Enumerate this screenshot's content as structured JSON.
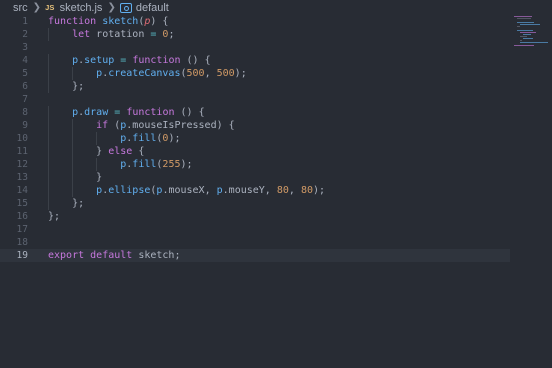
{
  "breadcrumb": {
    "folder": "src",
    "file_badge": "JS",
    "file": "sketch.js",
    "symbol": "default"
  },
  "icons": {
    "separator": "chevron-right-icon",
    "file_type": "javascript-file-icon",
    "symbol": "symbol-variable-icon"
  },
  "theme": {
    "background": "#282c34",
    "keyword": "#c678dd",
    "function": "#61afef",
    "variable": "#e06c75",
    "number": "#d19a66",
    "operator": "#56b6c2",
    "text": "#abb2bf",
    "line_number": "#5c6370"
  },
  "editor": {
    "active_line": 19,
    "lines": [
      {
        "n": "1",
        "tokens": [
          {
            "t": "function ",
            "c": "kw"
          },
          {
            "t": "sketch",
            "c": "fn"
          },
          {
            "t": "(",
            "c": "pl"
          },
          {
            "t": "p",
            "c": "pr"
          },
          {
            "t": ") {",
            "c": "pl"
          }
        ]
      },
      {
        "n": "2",
        "indent": 1,
        "tokens": [
          {
            "t": "let ",
            "c": "kw"
          },
          {
            "t": "rotation ",
            "c": "pl"
          },
          {
            "t": "=",
            "c": "op"
          },
          {
            "t": " ",
            "c": "pl"
          },
          {
            "t": "0",
            "c": "nm"
          },
          {
            "t": ";",
            "c": "pl"
          }
        ]
      },
      {
        "n": "3",
        "tokens": []
      },
      {
        "n": "4",
        "indent": 1,
        "tokens": [
          {
            "t": "p",
            "c": "fn"
          },
          {
            "t": ".",
            "c": "pl"
          },
          {
            "t": "setup",
            "c": "fn"
          },
          {
            "t": " ",
            "c": "pl"
          },
          {
            "t": "=",
            "c": "op"
          },
          {
            "t": " ",
            "c": "pl"
          },
          {
            "t": "function",
            "c": "kw"
          },
          {
            "t": " () {",
            "c": "pl"
          }
        ]
      },
      {
        "n": "5",
        "indent": 2,
        "tokens": [
          {
            "t": "p",
            "c": "fn"
          },
          {
            "t": ".",
            "c": "pl"
          },
          {
            "t": "createCanvas",
            "c": "fn"
          },
          {
            "t": "(",
            "c": "pl"
          },
          {
            "t": "500",
            "c": "nm"
          },
          {
            "t": ", ",
            "c": "pl"
          },
          {
            "t": "500",
            "c": "nm"
          },
          {
            "t": ");",
            "c": "pl"
          }
        ]
      },
      {
        "n": "6",
        "indent": 1,
        "tokens": [
          {
            "t": "};",
            "c": "pl"
          }
        ]
      },
      {
        "n": "7",
        "tokens": []
      },
      {
        "n": "8",
        "indent": 1,
        "tokens": [
          {
            "t": "p",
            "c": "fn"
          },
          {
            "t": ".",
            "c": "pl"
          },
          {
            "t": "draw",
            "c": "fn"
          },
          {
            "t": " ",
            "c": "pl"
          },
          {
            "t": "=",
            "c": "op"
          },
          {
            "t": " ",
            "c": "pl"
          },
          {
            "t": "function",
            "c": "kw"
          },
          {
            "t": " () {",
            "c": "pl"
          }
        ]
      },
      {
        "n": "9",
        "indent": 2,
        "tokens": [
          {
            "t": "if",
            "c": "kw"
          },
          {
            "t": " (",
            "c": "pl"
          },
          {
            "t": "p",
            "c": "fn"
          },
          {
            "t": ".mouseIsPressed) {",
            "c": "pl"
          }
        ]
      },
      {
        "n": "10",
        "indent": 3,
        "tokens": [
          {
            "t": "p",
            "c": "fn"
          },
          {
            "t": ".",
            "c": "pl"
          },
          {
            "t": "fill",
            "c": "fn"
          },
          {
            "t": "(",
            "c": "pl"
          },
          {
            "t": "0",
            "c": "nm"
          },
          {
            "t": ");",
            "c": "pl"
          }
        ]
      },
      {
        "n": "11",
        "indent": 2,
        "tokens": [
          {
            "t": "} ",
            "c": "pl"
          },
          {
            "t": "else",
            "c": "kw"
          },
          {
            "t": " {",
            "c": "pl"
          }
        ]
      },
      {
        "n": "12",
        "indent": 3,
        "tokens": [
          {
            "t": "p",
            "c": "fn"
          },
          {
            "t": ".",
            "c": "pl"
          },
          {
            "t": "fill",
            "c": "fn"
          },
          {
            "t": "(",
            "c": "pl"
          },
          {
            "t": "255",
            "c": "nm"
          },
          {
            "t": ");",
            "c": "pl"
          }
        ]
      },
      {
        "n": "13",
        "indent": 2,
        "tokens": [
          {
            "t": "}",
            "c": "pl"
          }
        ]
      },
      {
        "n": "14",
        "indent": 2,
        "tokens": [
          {
            "t": "p",
            "c": "fn"
          },
          {
            "t": ".",
            "c": "pl"
          },
          {
            "t": "ellipse",
            "c": "fn"
          },
          {
            "t": "(",
            "c": "pl"
          },
          {
            "t": "p",
            "c": "fn"
          },
          {
            "t": ".mouseX, ",
            "c": "pl"
          },
          {
            "t": "p",
            "c": "fn"
          },
          {
            "t": ".mouseY, ",
            "c": "pl"
          },
          {
            "t": "80",
            "c": "nm"
          },
          {
            "t": ", ",
            "c": "pl"
          },
          {
            "t": "80",
            "c": "nm"
          },
          {
            "t": ");",
            "c": "pl"
          }
        ]
      },
      {
        "n": "15",
        "indent": 1,
        "tokens": [
          {
            "t": "};",
            "c": "pl"
          }
        ]
      },
      {
        "n": "16",
        "tokens": [
          {
            "t": "};",
            "c": "pl"
          }
        ]
      },
      {
        "n": "17",
        "tokens": []
      },
      {
        "n": "18",
        "tokens": []
      },
      {
        "n": "19",
        "tokens": [
          {
            "t": "export",
            "c": "kw"
          },
          {
            "t": " ",
            "c": "pl"
          },
          {
            "t": "default",
            "c": "kw"
          },
          {
            "t": " sketch;",
            "c": "pl"
          }
        ]
      }
    ]
  }
}
